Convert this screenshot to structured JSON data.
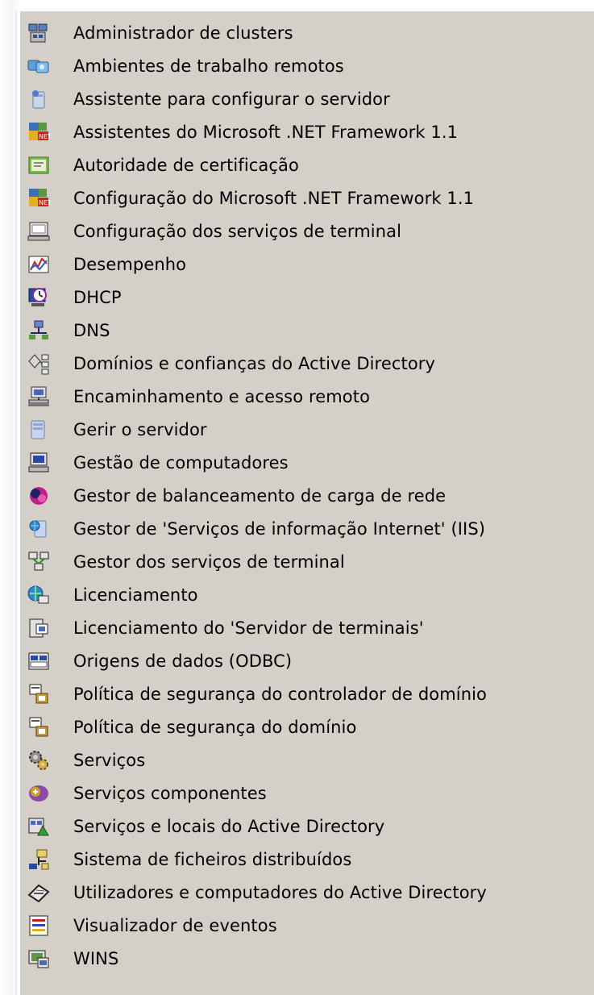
{
  "menu": {
    "items": [
      {
        "label": "Administrador de clusters",
        "icon": "cluster-admin-icon"
      },
      {
        "label": "Ambientes de trabalho remotos",
        "icon": "remote-desktops-icon"
      },
      {
        "label": "Assistente para configurar o servidor",
        "icon": "configure-server-wizard-icon"
      },
      {
        "label": "Assistentes do Microsoft .NET Framework 1.1",
        "icon": "dotnet-wizards-icon"
      },
      {
        "label": "Autoridade de certificação",
        "icon": "certification-authority-icon"
      },
      {
        "label": "Configuração do Microsoft .NET Framework 1.1",
        "icon": "dotnet-configuration-icon"
      },
      {
        "label": "Configuração dos serviços de terminal",
        "icon": "terminal-services-config-icon"
      },
      {
        "label": "Desempenho",
        "icon": "performance-icon"
      },
      {
        "label": "DHCP",
        "icon": "dhcp-icon"
      },
      {
        "label": "DNS",
        "icon": "dns-icon"
      },
      {
        "label": "Domínios e confianças do Active Directory",
        "icon": "ad-domains-trusts-icon"
      },
      {
        "label": "Encaminhamento e acesso remoto",
        "icon": "routing-remote-access-icon"
      },
      {
        "label": "Gerir o servidor",
        "icon": "manage-server-icon"
      },
      {
        "label": "Gestão de computadores",
        "icon": "computer-management-icon"
      },
      {
        "label": "Gestor de balanceamento de carga de rede",
        "icon": "network-load-balancing-icon"
      },
      {
        "label": "Gestor de 'Serviços de informação Internet' (IIS)",
        "icon": "iis-manager-icon"
      },
      {
        "label": "Gestor dos serviços de terminal",
        "icon": "terminal-services-manager-icon"
      },
      {
        "label": "Licenciamento",
        "icon": "licensing-icon"
      },
      {
        "label": "Licenciamento do 'Servidor de terminais'",
        "icon": "terminal-server-licensing-icon"
      },
      {
        "label": "Origens de dados (ODBC)",
        "icon": "odbc-data-sources-icon"
      },
      {
        "label": "Política de segurança do controlador de domínio",
        "icon": "dc-security-policy-icon"
      },
      {
        "label": "Política de segurança do domínio",
        "icon": "domain-security-policy-icon"
      },
      {
        "label": "Serviços",
        "icon": "services-icon"
      },
      {
        "label": "Serviços componentes",
        "icon": "component-services-icon"
      },
      {
        "label": "Serviços e locais do Active Directory",
        "icon": "ad-sites-services-icon"
      },
      {
        "label": "Sistema de ficheiros distribuídos",
        "icon": "dfs-icon"
      },
      {
        "label": "Utilizadores e computadores do Active Directory",
        "icon": "ad-users-computers-icon"
      },
      {
        "label": "Visualizador de eventos",
        "icon": "event-viewer-icon"
      },
      {
        "label": "WINS",
        "icon": "wins-icon"
      }
    ]
  },
  "colors": {
    "menu_background": "#d4d0c8",
    "text": "#000000"
  }
}
